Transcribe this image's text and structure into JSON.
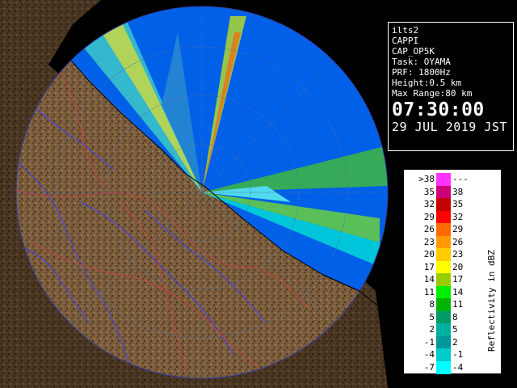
{
  "info": {
    "lines": [
      "ilts2",
      "CAPPI",
      "CAP_OP5K",
      "Task: OYAMA",
      "PRF: 1800Hz",
      "Height:0.5 km",
      "Max Range:80 km"
    ],
    "time": "07:30:00",
    "date": "29 JUL 2019 JST"
  },
  "legend": {
    "title": "Reflectivity in dBZ",
    "rows": [
      {
        "left": ">38",
        "right": "---",
        "color": "#ff33ff"
      },
      {
        "left": "35",
        "right": "38",
        "color": "#cc0077"
      },
      {
        "left": "32",
        "right": "35",
        "color": "#c40000"
      },
      {
        "left": "29",
        "right": "32",
        "color": "#ff0000"
      },
      {
        "left": "26",
        "right": "29",
        "color": "#ff6a00"
      },
      {
        "left": "23",
        "right": "26",
        "color": "#ff9900"
      },
      {
        "left": "20",
        "right": "23",
        "color": "#ffcc00"
      },
      {
        "left": "17",
        "right": "20",
        "color": "#ffff00"
      },
      {
        "left": "14",
        "right": "17",
        "color": "#99cc00"
      },
      {
        "left": "11",
        "right": "14",
        "color": "#00ee00"
      },
      {
        "left": "8",
        "right": "11",
        "color": "#00b400"
      },
      {
        "left": "5",
        "right": "8",
        "color": "#009a66"
      },
      {
        "left": "2",
        "right": "5",
        "color": "#00b0a0"
      },
      {
        "left": "-1",
        "right": "2",
        "color": "#009999"
      },
      {
        "left": "-4",
        "right": "-1",
        "color": "#00cccc"
      },
      {
        "left": "-7",
        "right": "-4",
        "color": "#00ffff"
      }
    ]
  },
  "colors": {
    "sea": "#0060e8",
    "land": "#7a5c3c",
    "river": "#4040ff",
    "boundary": "#c04040"
  }
}
